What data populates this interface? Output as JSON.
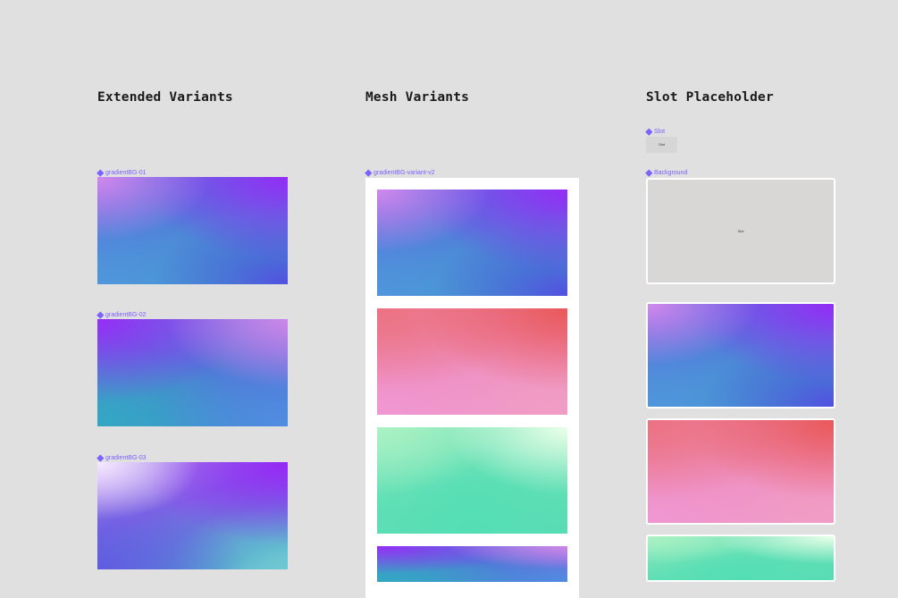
{
  "sections": {
    "extended": "Extended Variants",
    "mesh": "Mesh Variants",
    "slot": "Slot Placeholder"
  },
  "labels": {
    "gradient_01": "gradientBG-01",
    "gradient_02": "gradientBG-02",
    "gradient_03": "gradientBG-03",
    "variant_v2": "gradientBG-variant-v2",
    "slot": "Slot",
    "background": "Background"
  },
  "placeholders": {
    "slot_text": "Slot",
    "background_text": "Slot"
  },
  "colors": {
    "canvas": "#e0e0e0",
    "component_label": "#7b61ff"
  }
}
